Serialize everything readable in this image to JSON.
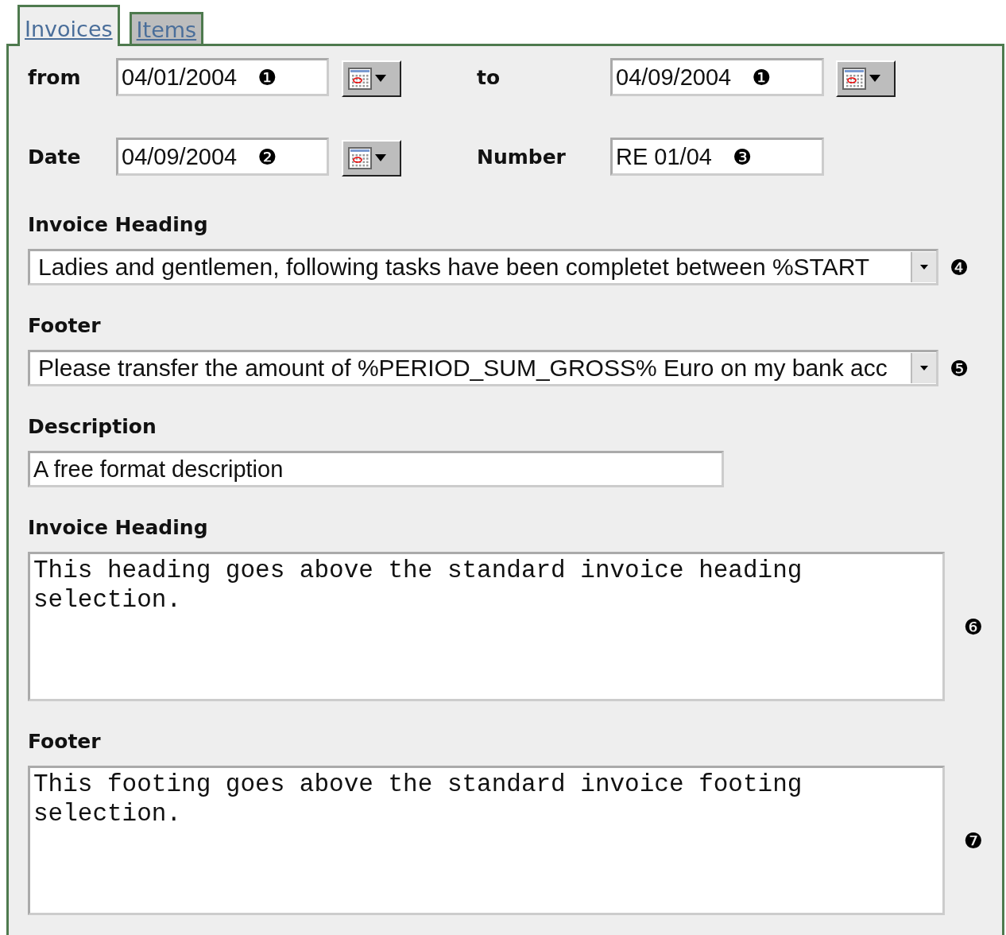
{
  "tabs": [
    {
      "label": "Invoices",
      "selected": true
    },
    {
      "label": "Items",
      "selected": false
    }
  ],
  "period": {
    "from": {
      "label": "from",
      "value": "04/01/2004",
      "callout": "❶"
    },
    "to": {
      "label": "to",
      "value": "04/09/2004",
      "callout": "❶"
    }
  },
  "date": {
    "label": "Date",
    "value": "04/09/2004",
    "callout": "❷"
  },
  "number": {
    "label": "Number",
    "value": "RE 01/04",
    "callout": "❸"
  },
  "heading_select": {
    "label": "Invoice Heading",
    "value": "Ladies and gentlemen, following tasks have been completet between %START",
    "callout": "❹"
  },
  "footer_select": {
    "label": "Footer",
    "value": "Please transfer the amount of %PERIOD_SUM_GROSS% Euro on my bank acc",
    "callout": "❺"
  },
  "description": {
    "label": "Description",
    "value": "A free format description"
  },
  "heading_text": {
    "label": "Invoice Heading",
    "value": "This heading goes above the standard invoice heading selection.",
    "callout": "❻"
  },
  "footer_text": {
    "label": "Footer",
    "value": "This footing goes above the standard invoice footing selection.",
    "callout": "❼"
  }
}
